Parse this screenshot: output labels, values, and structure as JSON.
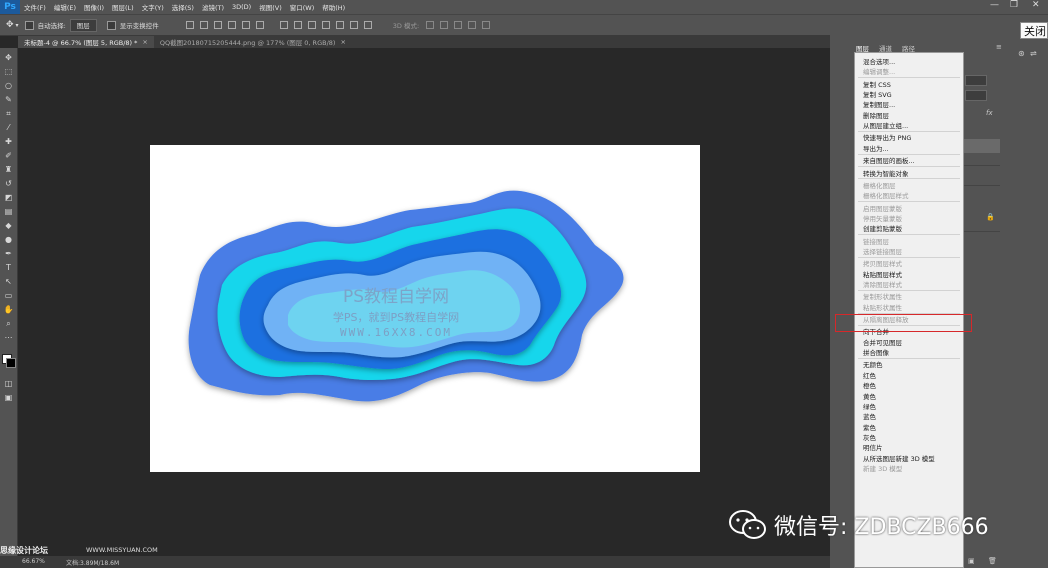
{
  "app": {
    "logo": "Ps"
  },
  "menubar": {
    "items": [
      "文件(F)",
      "编辑(E)",
      "图像(I)",
      "图层(L)",
      "文字(Y)",
      "选择(S)",
      "滤镜(T)",
      "3D(D)",
      "视图(V)",
      "窗口(W)",
      "帮助(H)"
    ],
    "window_controls": [
      "—",
      "❐",
      "✕"
    ]
  },
  "options": {
    "auto_select_label": "自动选择:",
    "auto_select_value": "图层",
    "show_transform_label": "显示变换控件",
    "mode_3d_label": "3D 模式:"
  },
  "tabs": [
    {
      "label": "未标题-4 @ 66.7% (图层 5, RGB/8) *",
      "close": "×"
    },
    {
      "label": "QQ截图20180715205444.png @ 177% (图层 0, RGB/8)",
      "close": "×"
    }
  ],
  "panel": {
    "tabs": [
      "图层",
      "通道",
      "路径"
    ]
  },
  "canvas": {
    "watermark_title": "PS教程自学网",
    "watermark_sub": "学PS，就到PS教程自学网",
    "watermark_url": "WWW.16XX8.COM"
  },
  "status": {
    "zoom": "66.67%",
    "doc": "文档:3.89M/18.6M"
  },
  "tooltip": {
    "close_label": "关闭"
  },
  "context_menu": {
    "items": [
      {
        "label": "混合选项...",
        "enabled": true
      },
      {
        "label": "编辑调整...",
        "enabled": false
      },
      {
        "sep": true
      },
      {
        "label": "复制 CSS",
        "enabled": true
      },
      {
        "label": "复制 SVG",
        "enabled": true
      },
      {
        "label": "复制图层...",
        "enabled": true
      },
      {
        "label": "删除图层",
        "enabled": true
      },
      {
        "label": "从图层建立组...",
        "enabled": true
      },
      {
        "sep": true
      },
      {
        "label": "快速导出为 PNG",
        "enabled": true
      },
      {
        "label": "导出为...",
        "enabled": true
      },
      {
        "sep": true
      },
      {
        "label": "来自图层的画板...",
        "enabled": true
      },
      {
        "sep": true
      },
      {
        "label": "转换为智能对象",
        "enabled": true
      },
      {
        "sep": true
      },
      {
        "label": "栅格化图层",
        "enabled": false
      },
      {
        "label": "栅格化图层样式",
        "enabled": false
      },
      {
        "sep": true
      },
      {
        "label": "启用图层蒙版",
        "enabled": false
      },
      {
        "label": "停用矢量蒙版",
        "enabled": false
      },
      {
        "label": "创建剪贴蒙版",
        "enabled": true
      },
      {
        "sep": true
      },
      {
        "label": "链接图层",
        "enabled": false
      },
      {
        "label": "选择链接图层",
        "enabled": false
      },
      {
        "sep": true
      },
      {
        "label": "拷贝图层样式",
        "enabled": false
      },
      {
        "label": "粘贴图层样式",
        "enabled": true,
        "highlighted": true
      },
      {
        "label": "清除图层样式",
        "enabled": false
      },
      {
        "sep": true
      },
      {
        "label": "复制形状属性",
        "enabled": false
      },
      {
        "label": "粘贴形状属性",
        "enabled": false
      },
      {
        "sep": true
      },
      {
        "label": "从隔离图层释放",
        "enabled": false
      },
      {
        "sep": true
      },
      {
        "label": "向下合并",
        "enabled": true
      },
      {
        "label": "合并可见图层",
        "enabled": true
      },
      {
        "label": "拼合图像",
        "enabled": true
      },
      {
        "sep": true
      },
      {
        "label": "无颜色",
        "enabled": true
      },
      {
        "label": "红色",
        "enabled": true
      },
      {
        "label": "橙色",
        "enabled": true
      },
      {
        "label": "黄色",
        "enabled": true
      },
      {
        "label": "绿色",
        "enabled": true
      },
      {
        "label": "蓝色",
        "enabled": true
      },
      {
        "label": "紫色",
        "enabled": true
      },
      {
        "label": "灰色",
        "enabled": true
      },
      {
        "label": "明信片",
        "enabled": true
      },
      {
        "label": "从所选图层新建 3D 模型",
        "enabled": true
      },
      {
        "label": "新建 3D 模型",
        "enabled": false
      }
    ]
  },
  "watermark": {
    "wechat": "微信号: ZDBCZB666",
    "site": "思缘设计论坛",
    "url": "WWW.MISSYUAN.COM"
  },
  "colors": {
    "highlight_border": "#d6282a",
    "accent_blue": "#31a8ff"
  }
}
